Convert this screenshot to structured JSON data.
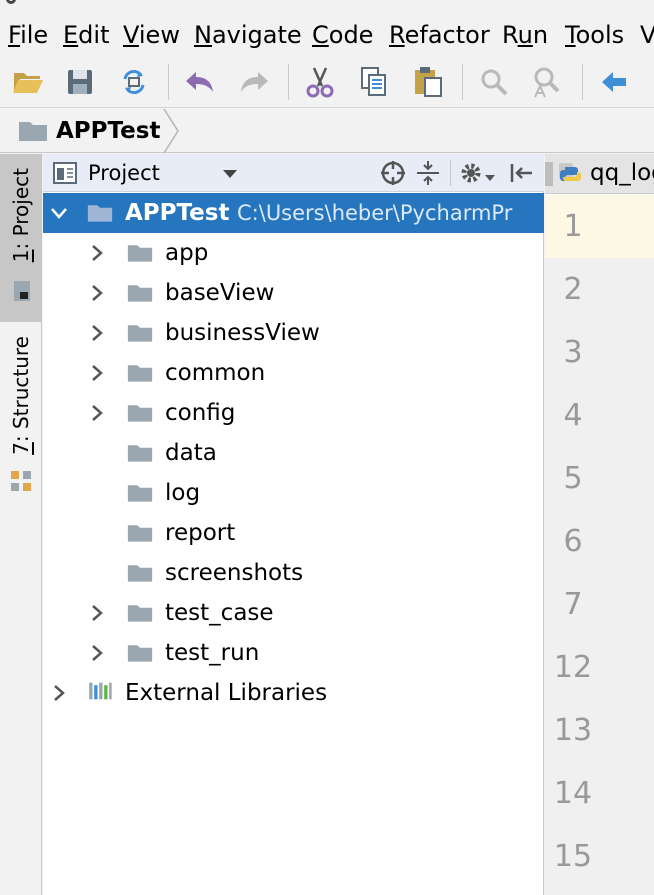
{
  "menu": [
    {
      "label": "File",
      "mnemonic_index": 0
    },
    {
      "label": "Edit",
      "mnemonic_index": 0
    },
    {
      "label": "View",
      "mnemonic_index": 0
    },
    {
      "label": "Navigate",
      "mnemonic_index": 0
    },
    {
      "label": "Code",
      "mnemonic_index": 0
    },
    {
      "label": "Refactor",
      "mnemonic_index": 0
    },
    {
      "label": "Run",
      "mnemonic_index": 1
    },
    {
      "label": "Tools",
      "mnemonic_index": 0
    },
    {
      "label": "V",
      "mnemonic_index": -1
    }
  ],
  "toolbar": {
    "buttons": [
      "open-folder-icon",
      "save-icon",
      "sync-icon",
      "undo-icon",
      "redo-icon",
      "cut-icon",
      "copy-icon",
      "paste-icon",
      "find-icon",
      "replace-icon",
      "back-icon"
    ]
  },
  "breadcrumb": {
    "label": "APPTest"
  },
  "left_strip": {
    "tabs": [
      {
        "num": "1",
        "label": ": Project"
      },
      {
        "num": "7",
        "label": ": Structure"
      }
    ]
  },
  "panel": {
    "title": "Project",
    "root": {
      "name": "APPTest",
      "path": "C:\\Users\\heber\\PycharmPr"
    },
    "items": [
      {
        "label": "app",
        "expandable": true
      },
      {
        "label": "baseView",
        "expandable": true
      },
      {
        "label": "businessView",
        "expandable": true
      },
      {
        "label": "common",
        "expandable": true
      },
      {
        "label": "config",
        "expandable": true
      },
      {
        "label": "data",
        "expandable": false
      },
      {
        "label": "log",
        "expandable": false
      },
      {
        "label": "report",
        "expandable": false
      },
      {
        "label": "screenshots",
        "expandable": false
      },
      {
        "label": "test_case",
        "expandable": true
      },
      {
        "label": "test_run",
        "expandable": true
      }
    ],
    "external": "External Libraries"
  },
  "editor": {
    "tab_label": "qq_log",
    "line_numbers": [
      "1",
      "2",
      "3",
      "4",
      "5",
      "6",
      "7",
      "12",
      "13",
      "14",
      "15"
    ]
  },
  "colors": {
    "selection": "#2675bf",
    "panel_header": "#e8ecf6",
    "folder": "#9aa7b0",
    "undo_purple": "#8c6bb1",
    "back_blue": "#3f8fd8",
    "current_line": "#fdf8e4"
  }
}
